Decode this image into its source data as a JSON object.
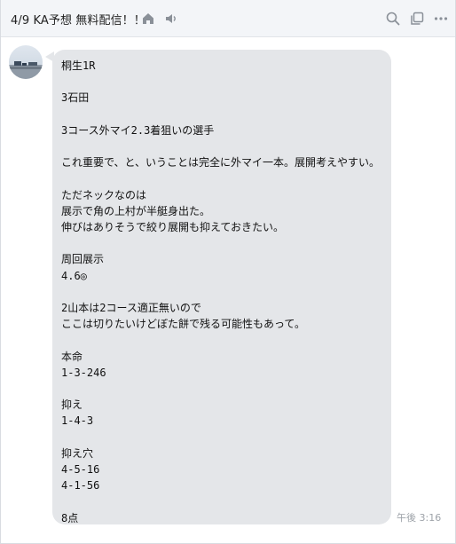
{
  "header": {
    "title": "4/9 KA予想 無料配信！！",
    "icons": [
      "home-icon",
      "speaker-icon",
      "search-icon",
      "copy-icon",
      "more-icon"
    ]
  },
  "message": {
    "text": "桐生1R\n\n3石田\n\n3コース外マイ2.3着狙いの選手\n\nこれ重要で、と、いうことは完全に外マイ一本。展開考えやすい。\n\nただネックなのは\n展示で角の上村が半艇身出た。\n伸びはありそうで絞り展開も抑えておきたい。\n\n周回展示\n4.6◎\n\n2山本は2コース適正無いので\nここは切りたいけどぼた餅で残る可能性もあって。\n\n本命\n1-3-246\n\n抑え\n1-4-3\n\n抑え穴\n4-5-16\n4-1-56\n\n8点",
    "time": "午後 3:16"
  },
  "colors": {
    "header_bg": "#f3f5f8",
    "bubble_bg": "#e4e6e9",
    "icon_gray": "#8a9098",
    "time_gray": "#9ea3a9"
  }
}
